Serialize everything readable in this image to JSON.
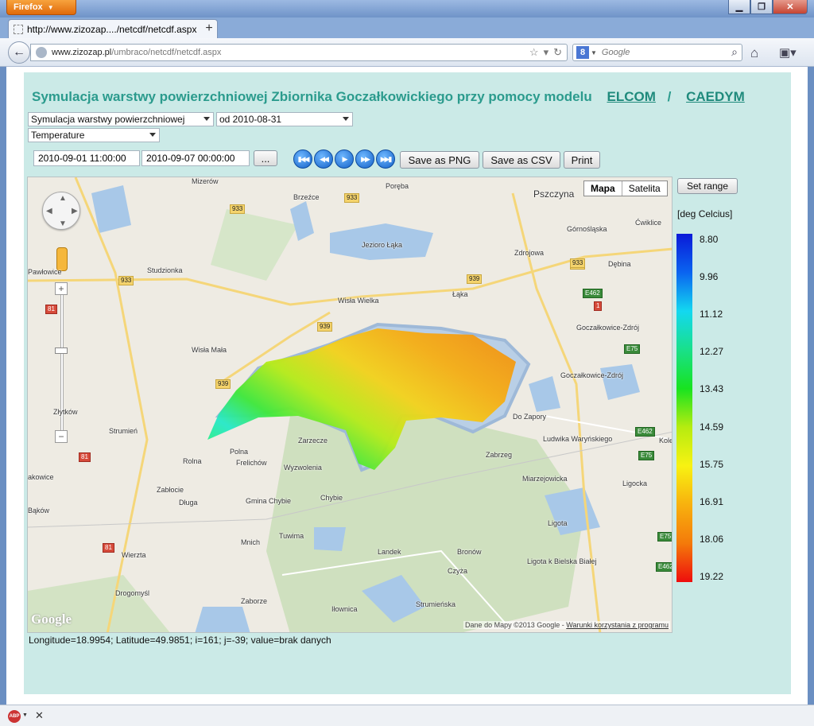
{
  "browser": {
    "app_button": "Firefox",
    "tab_title": "http://www.zizozap..../netcdf/netcdf.aspx",
    "url_domain": "www.zizozap.pl",
    "url_path": "/umbraco/netcdf/netcdf.aspx",
    "search_placeholder": "Google",
    "search_engine_letter": "8"
  },
  "page": {
    "heading": "Symulacja warstwy powierzchniowej Zbiornika Goczałkowickiego przy pomocy modelu",
    "link_elcom": "ELCOM",
    "separator": "/",
    "link_caedym": "CAEDYM",
    "select_simulation": "Symulacja warstwy powierzchniowej",
    "select_period": "od 2010-08-31",
    "select_variable": "Temperature",
    "date_from": "2010-09-01 11:00:00",
    "date_to": "2010-09-07 00:00:00",
    "ellipsis_button": "...",
    "save_png": "Save as PNG",
    "save_csv": "Save as CSV",
    "print": "Print",
    "status": "Longitude=18.9954; Latitude=49.9851; i=161; j=-39; value=brak danych"
  },
  "map": {
    "type_map": "Mapa",
    "type_satellite": "Satelita",
    "logo": "Google",
    "copyright": "Dane do Mapy ©2013 Google -",
    "terms": "Warunki korzystania z programu",
    "places": [
      {
        "name": "Mizerów"
      },
      {
        "name": "Brzeźce"
      },
      {
        "name": "Poręba"
      },
      {
        "name": "Pszczyna"
      },
      {
        "name": "Ćwiklice"
      },
      {
        "name": "Jezioro Łąka"
      },
      {
        "name": "Pawłowice"
      },
      {
        "name": "Studzionka"
      },
      {
        "name": "Łąka"
      },
      {
        "name": "Wisła Wielka"
      },
      {
        "name": "Goczałkowice-Zdrój"
      },
      {
        "name": "Wisła Mała"
      },
      {
        "name": "Goczałkowice-Zdrój"
      },
      {
        "name": "Złytków"
      },
      {
        "name": "Strumień"
      },
      {
        "name": "Zarzecze"
      },
      {
        "name": "Frelichów"
      },
      {
        "name": "Rolna"
      },
      {
        "name": "Zabrzeg"
      },
      {
        "name": "Ludwika Waryńskiego"
      },
      {
        "name": "Zabłocie"
      },
      {
        "name": "Gmina Chybie"
      },
      {
        "name": "Chybie"
      },
      {
        "name": "Ligota"
      },
      {
        "name": "Bąków"
      },
      {
        "name": "Mnich"
      },
      {
        "name": "Landek"
      },
      {
        "name": "Bronów"
      },
      {
        "name": "Ligota k Bielska Białej"
      },
      {
        "name": "Drogomyśl"
      },
      {
        "name": "Zaborze"
      },
      {
        "name": "Iłownica"
      },
      {
        "name": "Zdrojowa"
      },
      {
        "name": "Górnośląska"
      },
      {
        "name": "Do Zapory"
      },
      {
        "name": "Wyzwolenia"
      },
      {
        "name": "Długa"
      },
      {
        "name": "Czyża"
      },
      {
        "name": "Ligocka"
      },
      {
        "name": "Kolej"
      },
      {
        "name": "akowice"
      },
      {
        "name": "Dębina"
      },
      {
        "name": "Tuwima"
      },
      {
        "name": "Strumieńska"
      },
      {
        "name": "Wierzta"
      },
      {
        "name": "Polna"
      },
      {
        "name": "Miarzejowicka"
      }
    ],
    "roads": [
      "933",
      "933",
      "933",
      "933",
      "939",
      "939",
      "939",
      "933",
      "81",
      "81",
      "81",
      "E462",
      "1",
      "E75",
      "E462",
      "E75",
      "E75",
      "E462"
    ]
  },
  "legend": {
    "set_range": "Set range",
    "unit": "[deg Celcius]",
    "ticks": [
      "8.80",
      "9.96",
      "11.12",
      "12.27",
      "13.43",
      "14.59",
      "15.75",
      "16.91",
      "18.06",
      "19.22"
    ],
    "color_min": "#0a1ad8",
    "color_max": "#ee0d0d"
  }
}
